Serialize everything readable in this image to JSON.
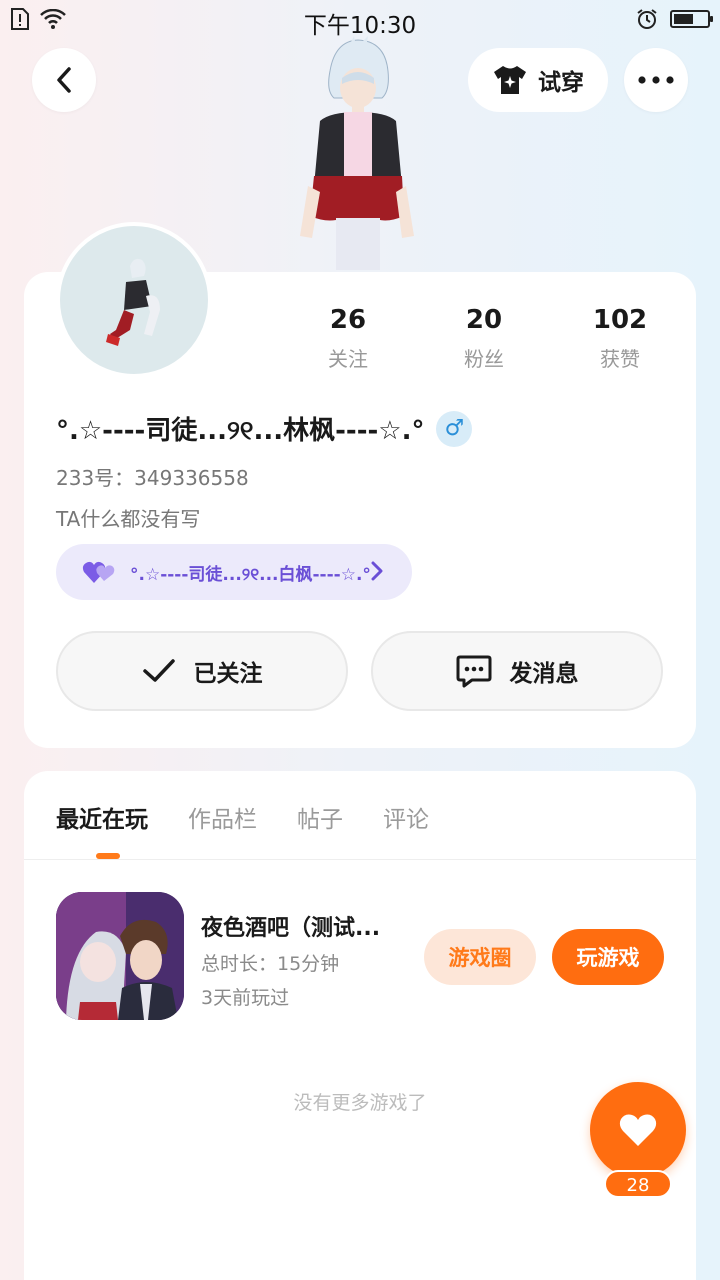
{
  "status_bar": {
    "time": "下午10:30",
    "battery_level": 0.6,
    "icons": [
      "sim-alert-icon",
      "wifi-icon",
      "alarm-icon",
      "battery-icon"
    ]
  },
  "header": {
    "tryon_label": "试穿",
    "icons": [
      "back-arrow-icon",
      "tshirt-sparkle-icon",
      "more-dots-icon"
    ]
  },
  "profile": {
    "stats": [
      {
        "value": "26",
        "label": "关注"
      },
      {
        "value": "20",
        "label": "粉丝"
      },
      {
        "value": "102",
        "label": "获赞"
      }
    ],
    "nickname": "°.☆----司徒...୨୧...林枫----☆.°",
    "gender_symbol": "♂",
    "uid": "233号：349336558",
    "bio": "TA什么都没有写",
    "cp_tag": "°.☆----司徒...୨୧...白枫----☆.°",
    "follow_label": "已关注",
    "message_label": "发消息"
  },
  "tabs": [
    {
      "label": "最近在玩",
      "active": true
    },
    {
      "label": "作品栏",
      "active": false
    },
    {
      "label": "帖子",
      "active": false
    },
    {
      "label": "评论",
      "active": false
    }
  ],
  "recent_game": {
    "title": "夜色酒吧（测试...",
    "duration": "总时长：15分钟",
    "last_played": "3天前玩过",
    "circle_label": "游戏圈",
    "play_label": "玩游戏"
  },
  "no_more_text": "没有更多游戏了",
  "fab": {
    "count": "28"
  },
  "colors": {
    "accent": "#ff6d10",
    "accent_soft": "#fde6d8",
    "cp_purple": "#6a4fd6",
    "gender_blue": "#2a8fd8"
  }
}
